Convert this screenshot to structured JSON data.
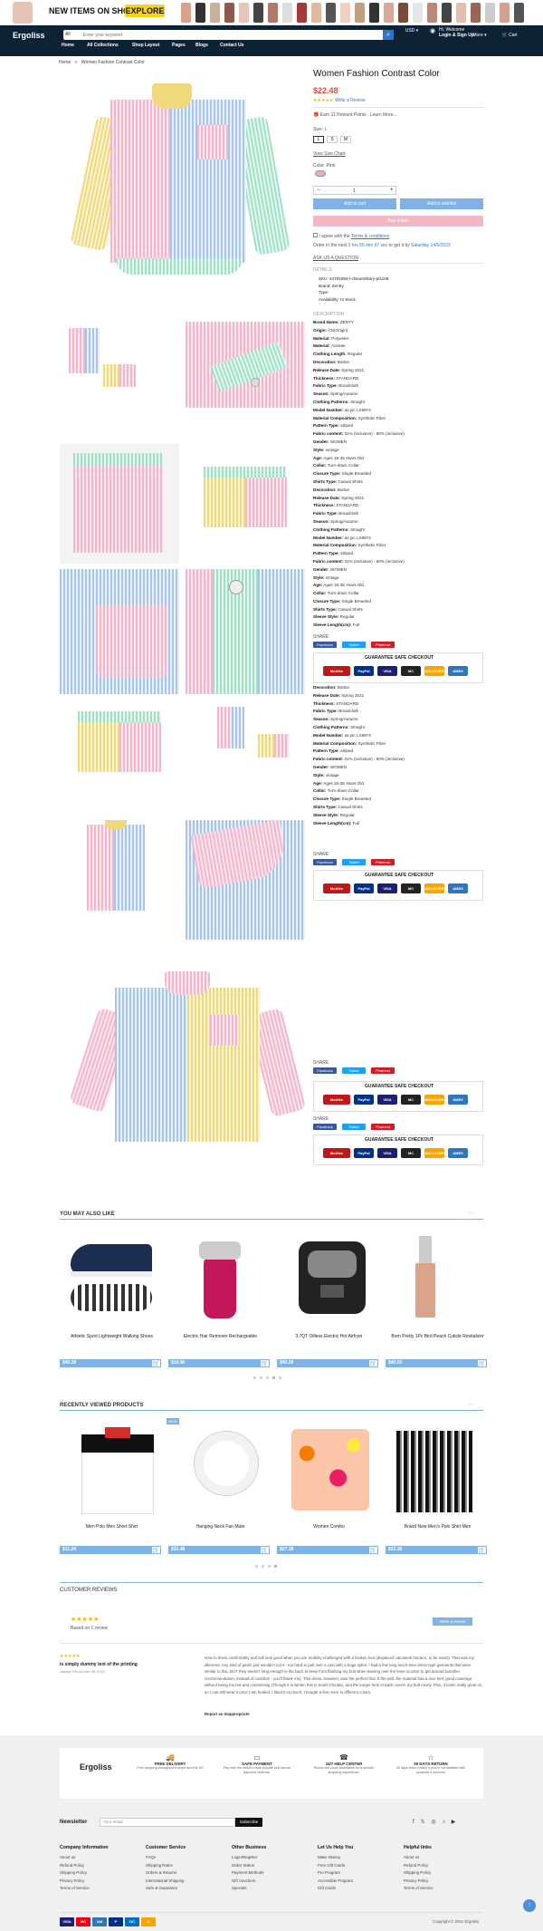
{
  "banner": {
    "text": "NEW ITEMS ON SHOP",
    "button": "EXPLORE"
  },
  "header": {
    "logo": "Ergoliss",
    "search_category": "All",
    "search_placeholder": "Enter your keyword",
    "currency": "USD",
    "welcome": "Hi, Welcome",
    "login": "Login & Sign Up",
    "more": "More",
    "cart": "Cart"
  },
  "nav": [
    "Home",
    "All Collections",
    "Shop Layout",
    "Pages",
    "Blogs",
    "Contact Us"
  ],
  "breadcrumb": [
    "Home",
    "»",
    "Women Fashion Contrast Color"
  ],
  "product": {
    "title": "Women Fashion Contrast Color",
    "price": "$22.48",
    "stars": "★★★★★",
    "write_review": "Write a Review",
    "reward": "Earn 11 Reward Points . Learn More...",
    "size_label": "Size: L",
    "sizes": [
      "L",
      "S",
      "M"
    ],
    "size_chart": "View Size Chart",
    "color_label": "Color: Pink",
    "qty_minus": "−",
    "qty": "1",
    "qty_plus": "+",
    "add_to_cart": "Add to cart",
    "add_to_wishlist": "Add to wishlist",
    "buy_now": "Buy it now",
    "agree_pre": "I agree with the",
    "agree_link": "Terms & conditions",
    "order_note_pre": "Order in the next",
    "order_note_time": "2 hrs 55 min 37 sec",
    "order_note_mid": "to get it by",
    "order_note_date": "Saturday 14/5/2022",
    "ask_question": "ASK US A QUESTION",
    "details_title": "DETAILS",
    "details": [
      "SKU: 44791993-l-chinamilitary-pt1108",
      "Brand: Zentry",
      "Type:",
      "Availability: In Stock"
    ],
    "description_title": "DESCRIPTION"
  },
  "description_block": [
    [
      "Brand Name:",
      "ZENTY"
    ],
    [
      "Origin:",
      "CN(Origin)"
    ],
    [
      "Material:",
      "Polyester"
    ],
    [
      "Material:",
      "Acetate"
    ],
    [
      "Clothing Length:",
      "Regular"
    ],
    [
      "Decoration:",
      "Button"
    ],
    [
      "Release Date:",
      "Spring 2021"
    ],
    [
      "Thickness:",
      "STANDARD"
    ],
    [
      "Fabric Type:",
      "Broadcloth"
    ],
    [
      "Season:",
      "Spring/Autumn"
    ],
    [
      "Clothing Patterns:",
      "Straight"
    ],
    [
      "Model Number:",
      "as pic LX9974"
    ],
    [
      "Material Composition:",
      "Synthetic Fiber"
    ],
    [
      "Pattern Type:",
      "striped"
    ],
    [
      "Fabric content:",
      "31% (inclusive) - 50% (inclusive)"
    ],
    [
      "Gender:",
      "WOMEN"
    ],
    [
      "Style:",
      "vintage"
    ],
    [
      "Age:",
      "Ages 18-35 Years Old"
    ],
    [
      "Collar:",
      "Turn-down Collar"
    ],
    [
      "Closure Type:",
      "Single Breasted"
    ],
    [
      "Shirts Type:",
      "Casual Shirts"
    ],
    [
      "Decoration:",
      "Button"
    ],
    [
      "Release Date:",
      "Spring 2021"
    ],
    [
      "Thickness:",
      "STANDARD"
    ],
    [
      "Fabric Type:",
      "Broadcloth"
    ],
    [
      "Season:",
      "Spring/Autumn"
    ],
    [
      "Clothing Patterns:",
      "Straight"
    ],
    [
      "Model Number:",
      "as pic LX9974"
    ],
    [
      "Material Composition:",
      "Synthetic Fiber"
    ],
    [
      "Pattern Type:",
      "striped"
    ],
    [
      "Fabric content:",
      "31% (inclusive) - 50% (inclusive)"
    ],
    [
      "Gender:",
      "WOMEN"
    ],
    [
      "Style:",
      "vintage"
    ],
    [
      "Age:",
      "Ages 18-35 Years Old"
    ],
    [
      "Collar:",
      "Turn-down Collar"
    ],
    [
      "Closure Type:",
      "Single Breasted"
    ],
    [
      "Shirts Type:",
      "Casual Shirts"
    ],
    [
      "Sleeve Style:",
      "Regular"
    ],
    [
      "Sleeve Length(cm):",
      "Full"
    ]
  ],
  "share": {
    "label": "SHARE",
    "facebook": "Facebook",
    "twitter": "Twitter",
    "pinterest": "Pinterest"
  },
  "checkout": {
    "title": "GUARANTEE SAFE CHECKOUT",
    "mcafee": "McAfee SECURE",
    "paypal": "PayPal",
    "visa": "VISA",
    "mastercard": "MC",
    "discover": "DISCOVER",
    "amex": "AMEX"
  },
  "also_like": {
    "title": "YOU MAY ALSO LIKE",
    "items": [
      {
        "name": "Athletic Sport Lightweight Walking Shoes",
        "price": "$40.28"
      },
      {
        "name": "Electric Hair Remover Rechargeable",
        "price": "$18.96"
      },
      {
        "name": "3.7QT Oilless Electric Hot Airfryer",
        "price": "$40.28"
      },
      {
        "name": "Born Pretty 1Pc Bird Peach Cuticle Revitalizer",
        "price": "$40.00"
      }
    ]
  },
  "recent": {
    "title": "RECENTLY VIEWED PRODUCTS",
    "new_badge": "NEW",
    "items": [
      {
        "name": "Men Polo Men Short Shirt",
        "price": "$11.24"
      },
      {
        "name": "Hanging Neck Fan Mute",
        "price": "$32.48"
      },
      {
        "name": "Women Combo",
        "price": "$27.18"
      },
      {
        "name": "Brand New Men's Polo Shirt Men",
        "price": "$23.36"
      }
    ]
  },
  "reviews": {
    "title": "CUSTOMER REVIEWS",
    "stars": "★★★★★",
    "based": "Based on 1 review",
    "write": "Write a review",
    "review_stars": "★★★★★",
    "review_title": "is simply dummy text of the printing",
    "review_meta": "Joseph Hill on Dec 05, 2021",
    "review_body": "How to dress comfortably and still look good when you are mobility-challenged with a broken foot (displaced calcaneal fracture, to be exact). That was my dilemma. Any kind of pants just wouldn't cut it - too hard to pull over a cast with a huge splint. I had a few long lunch-time dress-type garments that were similar to this, BUT they weren't long enough in the back to keep from flashing my butt when leaning over the knee scooter to get around (another recommendation, instead of crutches - you'll thank me). This dress, however, was the perfect find. It fits well, the material has a nice feel, good coverage without being too hot and constricting (Though it is winter, this is South Florida), and the longer hem in back covers my butt nicely. Plus, it looks really great on, so I can still wear it once I am healed. I liked it so much, I bought a few more in different colors.",
    "report": "Report as Inappropriate"
  },
  "features": [
    {
      "title": "FREE DELIVERY",
      "desc": "Free shipping throughout Europe and the US"
    },
    {
      "title": "SAFE PAYMENT",
      "desc": "Pay with the world's most popular and secure payment methods."
    },
    {
      "title": "24/7 HELP CENTER",
      "desc": "Round-the-clock assistance for a smooth shopping experience."
    },
    {
      "title": "30 DAYS RETURN",
      "desc": "30 days return policy if you're not satisfied with products & services"
    }
  ],
  "newsletter": {
    "label": "Newsletter",
    "placeholder": "Your email",
    "button": "Subscribe"
  },
  "footer_cols": [
    {
      "title": "Company Information",
      "items": [
        "About us",
        "Refund Policy",
        "Shipping Policy",
        "Privacy Policy",
        "Terms of Service"
      ]
    },
    {
      "title": "Customer Service",
      "items": [
        "FAQs",
        "Shipping Rates",
        "Orders & Returns",
        "International Shipping",
        "Safe & Guarantee"
      ]
    },
    {
      "title": "Other Business",
      "items": [
        "Login/Register",
        "Order Status",
        "Payment Methods",
        "Gift Vouchers",
        "Specials"
      ]
    },
    {
      "title": "Let Us Help You",
      "items": [
        "Make Money",
        "Free Gift Cards",
        "Pro Program",
        "Accessible Program",
        "Gift Cards"
      ]
    },
    {
      "title": "Helpful links",
      "items": [
        "About us",
        "Refund Policy",
        "Shipping Policy",
        "Privacy Policy",
        "Terms of Service"
      ]
    }
  ],
  "copyright": "Copyright © 2021 Ergoliss"
}
